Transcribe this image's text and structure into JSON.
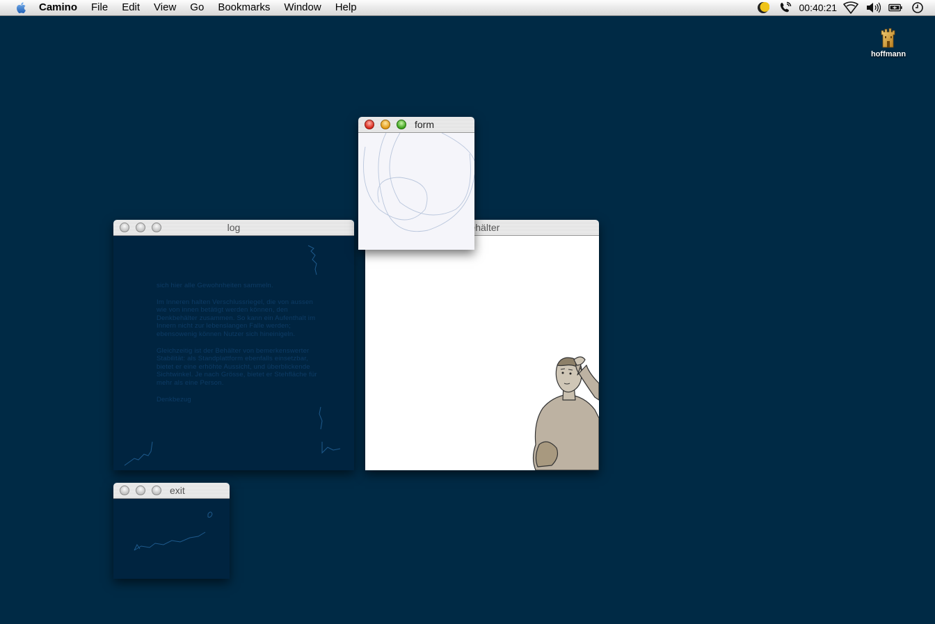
{
  "menubar": {
    "app_name": "Camino",
    "menus": [
      "File",
      "Edit",
      "View",
      "Go",
      "Bookmarks",
      "Window",
      "Help"
    ],
    "clock": "00:40:21",
    "status_icons": [
      "moon-icon",
      "phone-icon",
      "wifi-icon",
      "volume-icon",
      "battery-icon",
      "clock-icon"
    ]
  },
  "desktop": {
    "drive_label": "hoffmann"
  },
  "windows": {
    "form": {
      "title": "form"
    },
    "behalter": {
      "title": "behälter"
    },
    "log": {
      "title": "log",
      "paragraphs": [
        "sich hier alle Gewohnheiten sammeln.",
        "Im Inneren halten Verschlussriegel, die von aussen wie von innen betätigt werden können, den Denkbehälter zusammen. So kann ein Aufenthalt im Innern nicht zur lebenslangen Falle werden; ebensowenig können Nutzer sich hineinigeln.",
        "Gleichzeitig ist der Behälter von bemerkenswerter Stabilität: als Standplattform ebenfalls einsetzbar, bietet er eine erhöhte Aussicht, und überblickende Sichtwinkel. Je nach Grösse, bietet er Stehfläche für mehr als eine Person.",
        "Denkbezug"
      ]
    },
    "exit": {
      "title": "exit"
    }
  },
  "colors": {
    "desktop": "#002a45",
    "log_window_bg": "#002440",
    "log_text": "#0d3c66",
    "sketch_line": "#1e5a8c"
  }
}
